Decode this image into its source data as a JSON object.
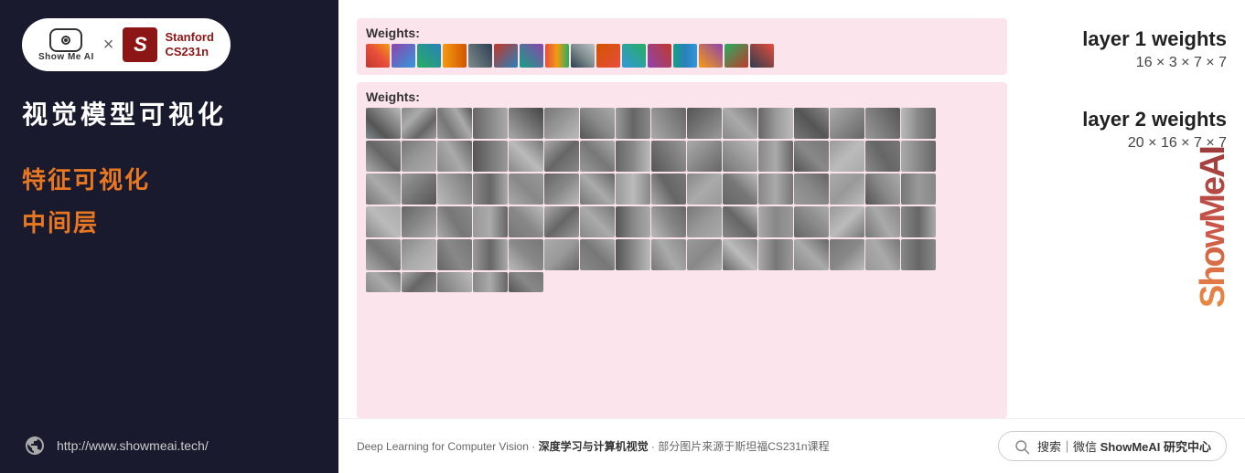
{
  "sidebar": {
    "logo": {
      "showmeai_text": "Show Me AI",
      "x_separator": "×",
      "stanford_letter": "S",
      "stanford_name": "Stanford",
      "stanford_course": "CS231n"
    },
    "main_title": "视觉模型可视化",
    "section1": "特征可视化",
    "section2": "中间层",
    "website": "http://www.showmeai.tech/"
  },
  "content": {
    "weights_label_1": "Weights:",
    "weights_label_2": "Weights:",
    "layer1": {
      "title": "layer 1 weights",
      "dims": "16 × 3 × 7 × 7"
    },
    "layer2": {
      "title": "layer 2 weights",
      "dims": "20 × 16 × 7 × 7"
    },
    "watermark": "ShowMeAI"
  },
  "footer": {
    "text_plain": "Deep Learning for Computer Vision · ",
    "text_bold": "深度学习与计算机视觉",
    "text_suffix": " · 部分图片来源于斯坦福CS231n课程",
    "search_label": "搜索｜微信",
    "search_brand": " ShowMeAI 研究中心"
  }
}
